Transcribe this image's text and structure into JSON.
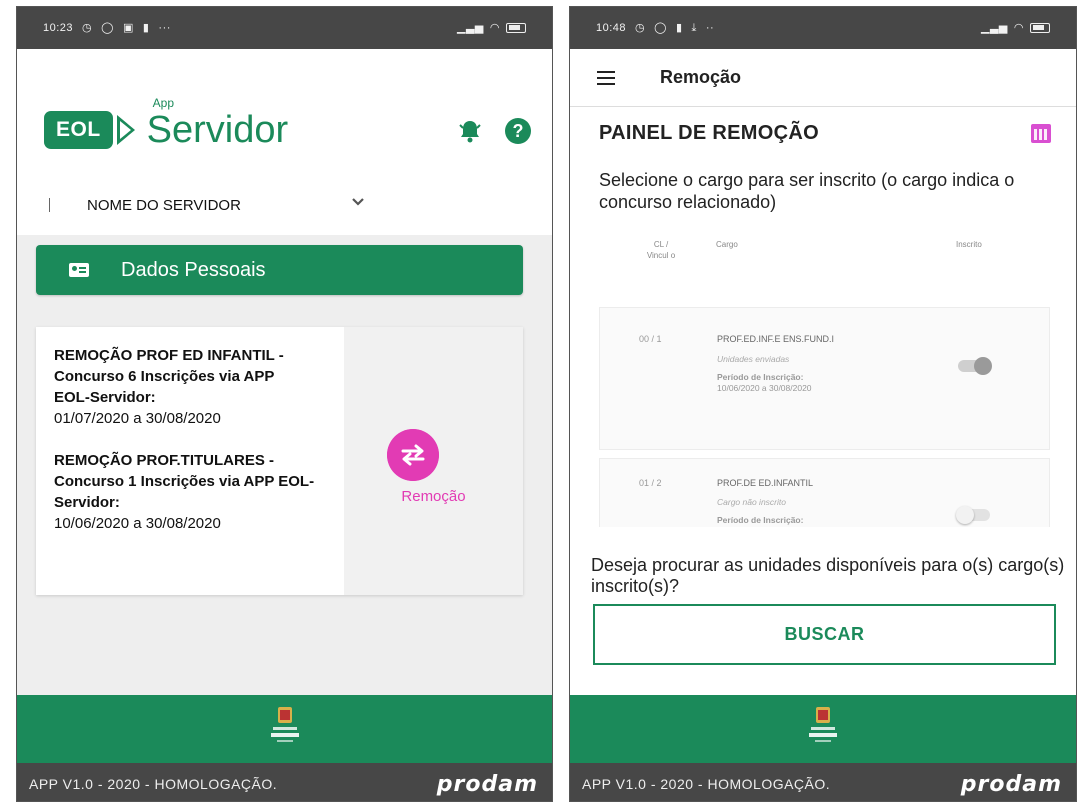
{
  "left": {
    "statusbar": {
      "time": "10:23",
      "dots": "···"
    },
    "logo": {
      "badge": "EOL",
      "app": "App",
      "name": "Servidor"
    },
    "icons": {
      "bell": "bell-icon",
      "help": "help-icon",
      "help_glyph": "?"
    },
    "server_name": "NOME DO SERVIDOR",
    "dados_button": "Dados Pessoais",
    "announcements": [
      {
        "title": "REMOÇÃO PROF ED INFANTIL - Concurso 6 Inscrições via APP EOL-Servidor:",
        "dates": "01/07/2020 a 30/08/2020"
      },
      {
        "title": "REMOÇÃO PROF.TITULARES - Concurso 1 Inscrições via APP EOL-Servidor:",
        "dates": "10/06/2020 a 30/08/2020"
      }
    ],
    "remocao_label": "Remoção",
    "footer": {
      "version": "APP V1.0 - 2020 - HOMOLOGAÇÃO.",
      "brand": "prodam"
    }
  },
  "right": {
    "statusbar": {
      "time": "10:48",
      "dots": "··"
    },
    "appbar_title": "Remoção",
    "painel_title": "PAINEL DE REMOÇÃO",
    "instruction": "Selecione o cargo para ser inscrito (o cargo indica o concurso relacionado)",
    "table_headers": {
      "cl": "CL / Vincul o",
      "cargo": "Cargo",
      "inscrito": "Inscrito"
    },
    "rows": [
      {
        "code": "00 / 1",
        "cargo": "PROF.ED.INF.E ENS.FUND.I",
        "status": "Unidades enviadas",
        "periodo_label": "Período de Inscrição:",
        "periodo": "10/06/2020 a 30/08/2020",
        "inscrito": true
      },
      {
        "code": "01 / 2",
        "cargo": "PROF.DE ED.INFANTIL",
        "status": "Cargo não inscrito",
        "periodo_label": "Período de Inscrição:",
        "periodo": "",
        "inscrito": false
      }
    ],
    "question": "Deseja procurar as unidades disponíveis para o(s) cargo(s) inscrito(s)?",
    "buscar_button": "BUSCAR",
    "footer": {
      "version": "APP V1.0 - 2020 - HOMOLOGAÇÃO.",
      "brand": "prodam"
    }
  },
  "colors": {
    "green": "#1b8a5a",
    "magenta": "#e23bb4",
    "statusbar": "#474747"
  }
}
